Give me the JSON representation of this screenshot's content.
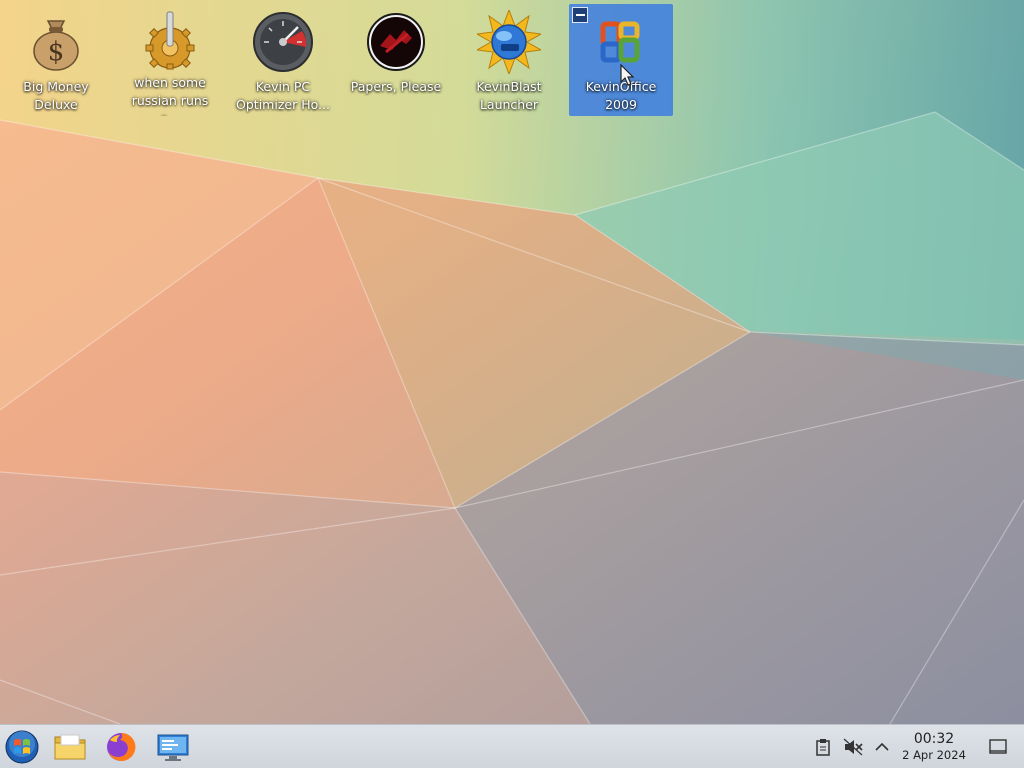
{
  "desktop": {
    "icons": [
      {
        "label": "Big Money\nDeluxe",
        "icon": "money-bag-icon"
      },
      {
        "label": "when some\nrussian runs a...",
        "icon": "joystick-gear-icon"
      },
      {
        "label": "Kevin PC\nOptimizer Ho...",
        "icon": "speedometer-icon"
      },
      {
        "label": "Papers, Please",
        "icon": "papers-please-icon"
      },
      {
        "label": "KevinBlast\nLauncher",
        "icon": "sun-globe-icon"
      },
      {
        "label": "KevinOffice\n2009",
        "icon": "office-logo-icon",
        "selected": true
      }
    ]
  },
  "taskbar": {
    "launchers": [
      {
        "name": "start-menu",
        "icon": "windows-orb-icon"
      },
      {
        "name": "file-manager",
        "icon": "folder-icon"
      },
      {
        "name": "firefox",
        "icon": "firefox-icon"
      },
      {
        "name": "system-settings",
        "icon": "monitor-settings-icon"
      }
    ],
    "tray": {
      "icons": [
        "clipboard-icon",
        "speaker-muted-icon",
        "chevron-up-icon",
        "show-desktop-icon"
      ],
      "time": "00:32",
      "date": "2 Apr 2024"
    }
  },
  "colors": {
    "selection": "#3d7de2",
    "taskbar": "#d9dee4"
  }
}
